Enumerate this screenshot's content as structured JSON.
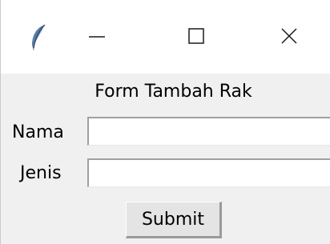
{
  "window": {
    "icon": "feather-icon",
    "controls": {
      "minimize_icon": "minimize-icon",
      "maximize_icon": "maximize-icon",
      "close_icon": "close-icon"
    }
  },
  "form": {
    "title": "Form Tambah Rak",
    "fields": {
      "nama": {
        "label": "Nama",
        "value": "",
        "placeholder": ""
      },
      "jenis": {
        "label": "Jenis",
        "value": "",
        "placeholder": ""
      }
    },
    "submit_label": "Submit"
  }
}
